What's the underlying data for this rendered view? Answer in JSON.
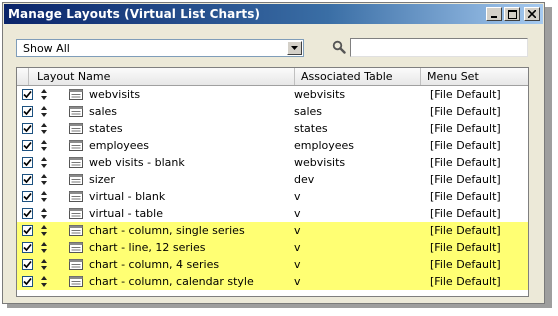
{
  "window": {
    "title": "Manage Layouts (Virtual List Charts)",
    "buttons": [
      "minimize-icon",
      "maximize-icon",
      "close-icon"
    ]
  },
  "filter": {
    "selected": "Show All"
  },
  "search": {
    "placeholder": "",
    "value": ""
  },
  "table": {
    "headers": {
      "layout": "Layout Name",
      "table": "Associated Table",
      "menu": "Menu Set"
    },
    "rows": [
      {
        "name": "webvisits",
        "table": "webvisits",
        "menu": "[File Default]",
        "highlighted": false,
        "checked": true
      },
      {
        "name": "sales",
        "table": "sales",
        "menu": "[File Default]",
        "highlighted": false,
        "checked": true
      },
      {
        "name": "states",
        "table": "states",
        "menu": "[File Default]",
        "highlighted": false,
        "checked": true
      },
      {
        "name": "employees",
        "table": "employees",
        "menu": "[File Default]",
        "highlighted": false,
        "checked": true
      },
      {
        "name": "web visits - blank",
        "table": "webvisits",
        "menu": "[File Default]",
        "highlighted": false,
        "checked": true
      },
      {
        "name": "sizer",
        "table": "dev",
        "menu": "[File Default]",
        "highlighted": false,
        "checked": true
      },
      {
        "name": "virtual - blank",
        "table": "v",
        "menu": "[File Default]",
        "highlighted": false,
        "checked": true
      },
      {
        "name": "virtual - table",
        "table": "v",
        "menu": "[File Default]",
        "highlighted": false,
        "checked": true
      },
      {
        "name": "chart - column, single series",
        "table": "v",
        "menu": "[File Default]",
        "highlighted": true,
        "checked": true
      },
      {
        "name": "chart - line, 12 series",
        "table": "v",
        "menu": "[File Default]",
        "highlighted": true,
        "checked": true
      },
      {
        "name": "chart - column, 4 series",
        "table": "v",
        "menu": "[File Default]",
        "highlighted": true,
        "checked": true
      },
      {
        "name": "chart - column, calendar style",
        "table": "v",
        "menu": "[File Default]",
        "highlighted": true,
        "checked": true
      }
    ]
  },
  "colors": {
    "highlight": "#ffff73",
    "titlebar": "#0a246a"
  }
}
